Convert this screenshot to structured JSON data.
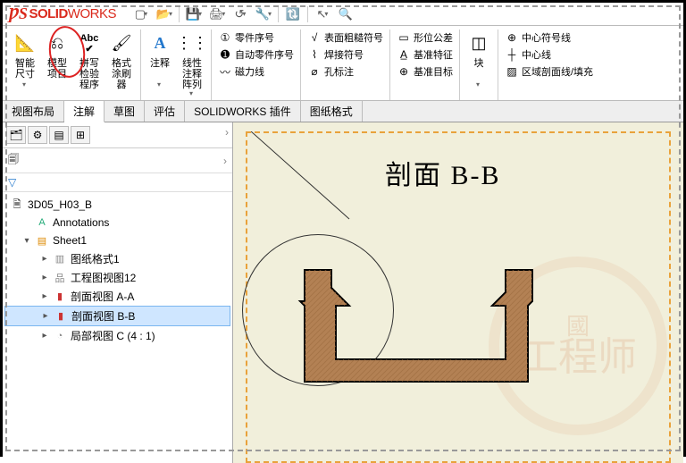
{
  "app": {
    "logo_prefix": "S",
    "logo_bold": "SOLID",
    "logo_thin": "WORKS"
  },
  "qat": [
    {
      "name": "new-icon",
      "glyph": "▢"
    },
    {
      "name": "open-icon",
      "glyph": "📂"
    },
    {
      "name": "save-icon",
      "glyph": "💾"
    },
    {
      "name": "print-icon",
      "glyph": "🖨"
    },
    {
      "name": "options-icon",
      "glyph": "�victory"
    },
    {
      "name": "rebuild-icon",
      "glyph": "🔃"
    },
    {
      "name": "sep",
      "glyph": "|"
    },
    {
      "name": "select-icon",
      "glyph": "↖"
    },
    {
      "name": "pan-icon",
      "glyph": "⇲"
    }
  ],
  "ribbon": {
    "big": [
      {
        "name": "smart-dimension",
        "label": "智能尺寸",
        "glyph": "↔"
      },
      {
        "name": "model-items",
        "label": "模型项目",
        "glyph": "⎌"
      },
      {
        "name": "spell-check",
        "label": "拼写检验程序",
        "glyph": "Abc"
      },
      {
        "name": "format-painter",
        "label": "格式涂刷器",
        "glyph": "🖌"
      },
      {
        "name": "note",
        "label": "注释",
        "glyph": "A"
      },
      {
        "name": "linear-note-pattern",
        "label": "线性注释阵列",
        "glyph": "⋮⋮"
      }
    ],
    "col1": [
      {
        "name": "balloon",
        "label": "零件序号",
        "glyph": "①"
      },
      {
        "name": "auto-balloon",
        "label": "自动零件序号",
        "glyph": "➊"
      },
      {
        "name": "magnetic-line",
        "label": "磁力线",
        "glyph": "〰"
      }
    ],
    "col2": [
      {
        "name": "surface-finish",
        "label": "表面粗糙符号",
        "glyph": "√"
      },
      {
        "name": "weld-symbol",
        "label": "焊接符号",
        "glyph": "⌇"
      },
      {
        "name": "hole-callout",
        "label": "孔标注",
        "glyph": "⌀"
      }
    ],
    "col3": [
      {
        "name": "geometric-tolerance",
        "label": "形位公差",
        "glyph": "▭"
      },
      {
        "name": "datum-feature",
        "label": "基准特征",
        "glyph": "A̲"
      },
      {
        "name": "datum-target",
        "label": "基准目标",
        "glyph": "⊕"
      }
    ],
    "col4big": {
      "name": "blocks",
      "label": "块",
      "glyph": "◫"
    },
    "col5": [
      {
        "name": "center-mark",
        "label": "中心符号线",
        "glyph": "⊕"
      },
      {
        "name": "centerline",
        "label": "中心线",
        "glyph": "┼"
      },
      {
        "name": "area-hatch",
        "label": "区域剖面线/填充",
        "glyph": "▨"
      }
    ]
  },
  "tabs": [
    {
      "name": "tab-view-layout",
      "label": "视图布局"
    },
    {
      "name": "tab-annotate",
      "label": "注解",
      "active": true
    },
    {
      "name": "tab-sketch",
      "label": "草图"
    },
    {
      "name": "tab-evaluate",
      "label": "评估"
    },
    {
      "name": "tab-sw-addins",
      "label": "SOLIDWORKS 插件"
    },
    {
      "name": "tab-sheet-format",
      "label": "图纸格式"
    }
  ],
  "tree": {
    "root": {
      "name": "3D05_H03_B",
      "glyph": "📄"
    },
    "items": [
      {
        "depth": 1,
        "exp": "",
        "name": "annotations",
        "label": "Annotations",
        "glyph": "A",
        "icolor": "#2a7"
      },
      {
        "depth": 1,
        "exp": "▾",
        "name": "sheet1",
        "label": "Sheet1",
        "glyph": "▤",
        "icolor": "#d80"
      },
      {
        "depth": 2,
        "exp": "▸",
        "name": "sheet-format1",
        "label": "图纸格式1",
        "glyph": "▥",
        "icolor": "#888"
      },
      {
        "depth": 2,
        "exp": "▸",
        "name": "drawing-view12",
        "label": "工程图视图12",
        "glyph": "品",
        "icolor": "#888"
      },
      {
        "depth": 2,
        "exp": "▸",
        "name": "section-view-a-a",
        "label": "剖面视图 A-A",
        "glyph": "▮",
        "icolor": "#c33"
      },
      {
        "depth": 2,
        "exp": "▸",
        "name": "section-view-b-b",
        "label": "剖面视图 B-B",
        "glyph": "▮",
        "icolor": "#c33",
        "sel": true
      },
      {
        "depth": 2,
        "exp": "▸",
        "name": "detail-view-c",
        "label": "局部视图 C (4 : 1)",
        "glyph": "◔",
        "icolor": "#888"
      }
    ]
  },
  "canvas": {
    "title": "剖面 B-B",
    "watermark_top": "國",
    "watermark_main": "工程师"
  }
}
